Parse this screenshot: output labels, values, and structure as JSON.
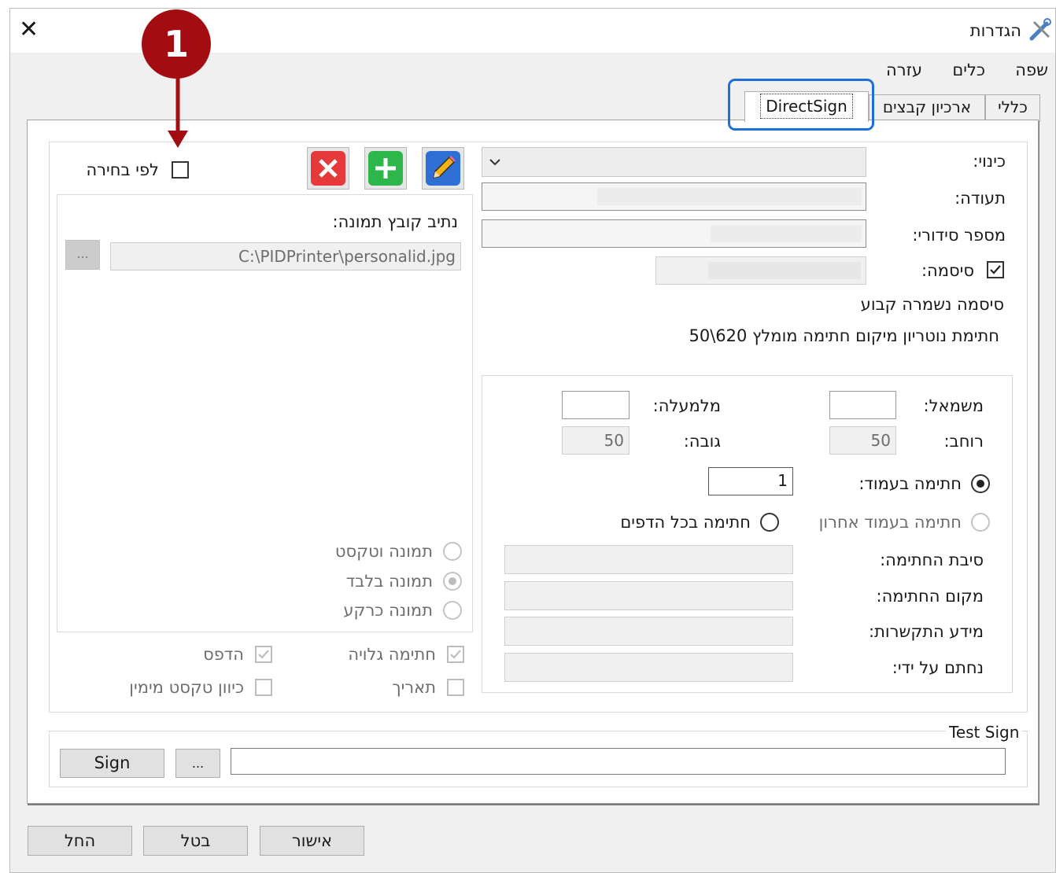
{
  "window": {
    "title": "הגדרות",
    "close_glyph": "✕"
  },
  "menu": [
    "שפה",
    "כלים",
    "עזרה"
  ],
  "tabs": [
    "כללי",
    "ארכיון קבצים",
    "DirectSign"
  ],
  "annotation": {
    "number": "1",
    "color": "#a30d12",
    "highlight_color": "#1e6fd9"
  },
  "left": {
    "by_choice_label": "לפי בחירה",
    "image_path_label": "נתיב קובץ תמונה:",
    "image_path_value": "C:\\PIDPrinter\\personalid.jpg",
    "browse_label": "...",
    "radio_image_text": "תמונה וטקסט",
    "radio_image_only": "תמונה בלבד",
    "radio_image_background": "תמונה כרקע",
    "cb_graphic_sign": "חתימה גלויה",
    "cb_print": "הדפס",
    "cb_date": "תאריך",
    "cb_text_orientation": "כיוון טקסט מימין"
  },
  "right": {
    "alias_label": "כינוי:",
    "certificate_label": "תעודה:",
    "serial_label": "מספר סידורי:",
    "password_label": "סיסמה:",
    "password_saved_text": "סיסמה נשמרה קבוע",
    "notary_text": "חתימת נוטריון מיקום חתימה מומלץ 620\\50",
    "left_label": "משמאל:",
    "top_label": "מלמעלה:",
    "width_label": "רוחב:",
    "width_value": "50",
    "height_label": "גובה:",
    "height_value": "50",
    "sign_on_page_label": "חתימה בעמוד:",
    "sign_on_page_value": "1",
    "sign_all_pages_label": "חתימה בכל הדפים",
    "sign_last_page_label": "חתימה בעמוד אחרון",
    "reason_label": "סיבת החתימה:",
    "location_label": "מקום החתימה:",
    "contact_label": "מידע התקשרות:",
    "signed_by_label": "נחתם על ידי:"
  },
  "test": {
    "title": "Test Sign",
    "sign_button": "Sign",
    "browse_label": "..."
  },
  "footer": {
    "ok": "אישור",
    "cancel": "בטל",
    "apply": "החל"
  }
}
